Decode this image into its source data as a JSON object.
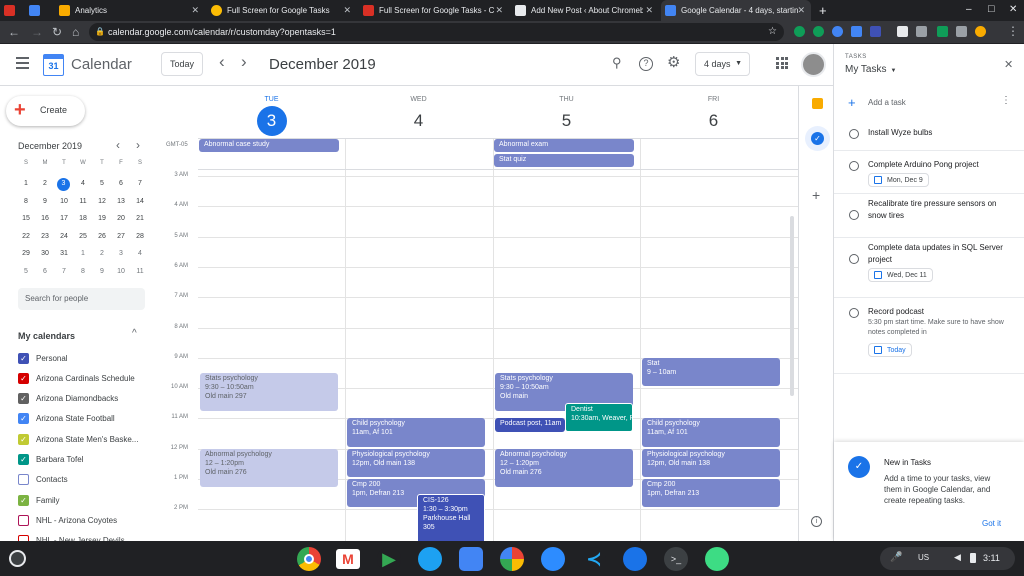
{
  "browser": {
    "tabs": [
      {
        "title": "",
        "color": "#d93025"
      },
      {
        "title": "",
        "color": "#4285f4"
      },
      {
        "title": "Analytics",
        "color": "#f9ab00"
      },
      {
        "title": "Full Screen for Google Tasks",
        "color": "#fbbc04"
      },
      {
        "title": "Full Screen for Google Tasks - Ch",
        "color": "#d93025"
      },
      {
        "title": "Add New Post ‹ About Chromeb",
        "color": "#e8eaed"
      },
      {
        "title": "Google Calendar - 4 days, startin",
        "color": "#4285f4"
      }
    ],
    "url": "calendar.google.com/calendar/r/customday?opentasks=1",
    "new_tab": "+",
    "window_controls": [
      "–",
      "□",
      "✕"
    ]
  },
  "header": {
    "app_name": "Calendar",
    "logo_day": "31",
    "today_label": "Today",
    "prev": "‹",
    "next": "›",
    "date_title": "December 2019",
    "view_label": "4 days"
  },
  "sidebar": {
    "create_label": "Create",
    "mini_month": "December 2019",
    "weekdays": [
      "S",
      "M",
      "T",
      "W",
      "T",
      "F",
      "S"
    ],
    "weeks": [
      [
        "1",
        "2",
        "3",
        "4",
        "5",
        "6",
        "7"
      ],
      [
        "8",
        "9",
        "10",
        "11",
        "12",
        "13",
        "14"
      ],
      [
        "15",
        "16",
        "17",
        "18",
        "19",
        "20",
        "21"
      ],
      [
        "22",
        "23",
        "24",
        "25",
        "26",
        "27",
        "28"
      ],
      [
        "29",
        "30",
        "31",
        "1",
        "2",
        "3",
        "4"
      ],
      [
        "5",
        "6",
        "7",
        "8",
        "9",
        "10",
        "11"
      ]
    ],
    "today_date": "3",
    "search_placeholder": "Search for people",
    "my_calendars_label": "My calendars",
    "calendars": [
      {
        "name": "Personal",
        "color": "#3f51b5",
        "checked": true
      },
      {
        "name": "Arizona Cardinals Schedule",
        "color": "#d50000",
        "checked": true
      },
      {
        "name": "Arizona Diamondbacks",
        "color": "#616161",
        "checked": true
      },
      {
        "name": "Arizona State Football",
        "color": "#4285f4",
        "checked": true
      },
      {
        "name": "Arizona State Men's Baske...",
        "color": "#c0ca33",
        "checked": true
      },
      {
        "name": "Barbara Tofel",
        "color": "#009688",
        "checked": true
      },
      {
        "name": "Contacts",
        "color": "#7986cb",
        "checked": false
      },
      {
        "name": "Family",
        "color": "#7cb342",
        "checked": true
      },
      {
        "name": "NHL - Arizona Coyotes",
        "color": "#ad1457",
        "checked": false
      },
      {
        "name": "NHL - New Jersey Devils",
        "color": "#d50000",
        "checked": false
      }
    ]
  },
  "grid": {
    "timezone": "GMT-05",
    "days": [
      {
        "dow": "TUE",
        "date": "3",
        "today": true
      },
      {
        "dow": "WED",
        "date": "4",
        "today": false
      },
      {
        "dow": "THU",
        "date": "5",
        "today": false
      },
      {
        "dow": "FRI",
        "date": "6",
        "today": false
      }
    ],
    "hours": [
      "3 AM",
      "4 AM",
      "5 AM",
      "6 AM",
      "7 AM",
      "8 AM",
      "9 AM",
      "10 AM",
      "11 AM",
      "12 PM",
      "1 PM",
      "2 PM"
    ],
    "allday": [
      {
        "day": 0,
        "row": 0,
        "title": "Abnormal case study"
      },
      {
        "day": 2,
        "row": 0,
        "title": "Abnormal exam"
      },
      {
        "day": 2,
        "row": 1,
        "title": "Stat quiz"
      }
    ],
    "events": [
      {
        "day": 0,
        "start": 9.5,
        "end": 10.83,
        "title": "Stats psychology",
        "time": "9:30 – 10:50am",
        "loc": "Old main 297",
        "color": "#c5cae9",
        "text": "#5f6368",
        "past": true
      },
      {
        "day": 0,
        "start": 12,
        "end": 13.33,
        "title": "Abnormal psychology",
        "time": "12 – 1:20pm",
        "loc": "Old main 276",
        "color": "#c5cae9",
        "text": "#5f6368",
        "past": true
      },
      {
        "day": 1,
        "start": 11,
        "end": 12,
        "title": "Child psychology",
        "time": "11am, Af 101",
        "loc": "",
        "color": "#7986cb",
        "text": "#ffffff",
        "past": false
      },
      {
        "day": 1,
        "start": 12,
        "end": 13,
        "title": "Physiological psychology",
        "time": "12pm, Old main 138",
        "loc": "",
        "color": "#7986cb",
        "text": "#ffffff",
        "past": false
      },
      {
        "day": 1,
        "start": 13,
        "end": 14,
        "title": "Cmp 200",
        "time": "1pm, Defran 213",
        "loc": "",
        "color": "#7986cb",
        "text": "#ffffff",
        "past": false
      },
      {
        "day": 1,
        "start": 13.5,
        "end": 15.5,
        "title": "CIS-126",
        "time": "1:30 – 3:30pm",
        "loc": "Parkhouse Hall 305",
        "color": "#3f51b5",
        "text": "#ffffff",
        "past": false,
        "indent": true
      },
      {
        "day": 2,
        "start": 9.5,
        "end": 10.83,
        "title": "Stats psychology",
        "time": "9:30 – 10:50am",
        "loc": "Old main",
        "color": "#7986cb",
        "text": "#ffffff",
        "past": false
      },
      {
        "day": 2,
        "start": 10.5,
        "end": 11.5,
        "title": "Dentist",
        "time": "10:30am, Weaver, R",
        "loc": "",
        "color": "#009688",
        "text": "#ffffff",
        "past": false,
        "indent": true
      },
      {
        "day": 2,
        "start": 11,
        "end": 11.5,
        "title": "Podcast post, 11am",
        "time": "",
        "loc": "",
        "color": "#3f51b5",
        "text": "#ffffff",
        "past": false,
        "narrow": true
      },
      {
        "day": 2,
        "start": 12,
        "end": 13.33,
        "title": "Abnormal psychology",
        "time": "12 – 1:20pm",
        "loc": "Old main 276",
        "color": "#7986cb",
        "text": "#ffffff",
        "past": false
      },
      {
        "day": 3,
        "start": 9,
        "end": 10,
        "title": "Stat",
        "time": "9 – 10am",
        "loc": "",
        "color": "#7986cb",
        "text": "#ffffff",
        "past": false
      },
      {
        "day": 3,
        "start": 11,
        "end": 12,
        "title": "Child psychology",
        "time": "11am, Af 101",
        "loc": "",
        "color": "#7986cb",
        "text": "#ffffff",
        "past": false
      },
      {
        "day": 3,
        "start": 12,
        "end": 13,
        "title": "Physiological psychology",
        "time": "12pm, Old main 138",
        "loc": "",
        "color": "#7986cb",
        "text": "#ffffff",
        "past": false
      },
      {
        "day": 3,
        "start": 13,
        "end": 14,
        "title": "Cmp 200",
        "time": "1pm, Defran 213",
        "loc": "",
        "color": "#7986cb",
        "text": "#ffffff",
        "past": false
      }
    ]
  },
  "tasks": {
    "section_label": "TASKS",
    "list_name": "My Tasks",
    "add_label": "Add a task",
    "items": [
      {
        "title": "Install Wyze bulbs",
        "note": "",
        "date": ""
      },
      {
        "title": "Complete Arduino Pong project",
        "note": "",
        "date": "Mon, Dec 9"
      },
      {
        "title": "Recalibrate tire pressure sensors on snow tires",
        "note": "",
        "date": ""
      },
      {
        "title": "Complete data updates in SQL Server project",
        "note": "",
        "date": "Wed, Dec 11"
      },
      {
        "title": "Record podcast",
        "note": "5:30 pm start time. Make sure to have show notes completed in",
        "date": "Today"
      }
    ],
    "promo": {
      "title": "New in Tasks",
      "body": "Add a time to your tasks, view them in Google Calendar, and create repeating tasks.",
      "action": "Got it"
    }
  },
  "shelf": {
    "apps": [
      "chrome",
      "gmail",
      "play-store",
      "twitter",
      "files",
      "photos",
      "zoom",
      "vscode",
      "messages",
      "terminal",
      "android-studio"
    ],
    "ime": "US",
    "time": "3:11"
  }
}
